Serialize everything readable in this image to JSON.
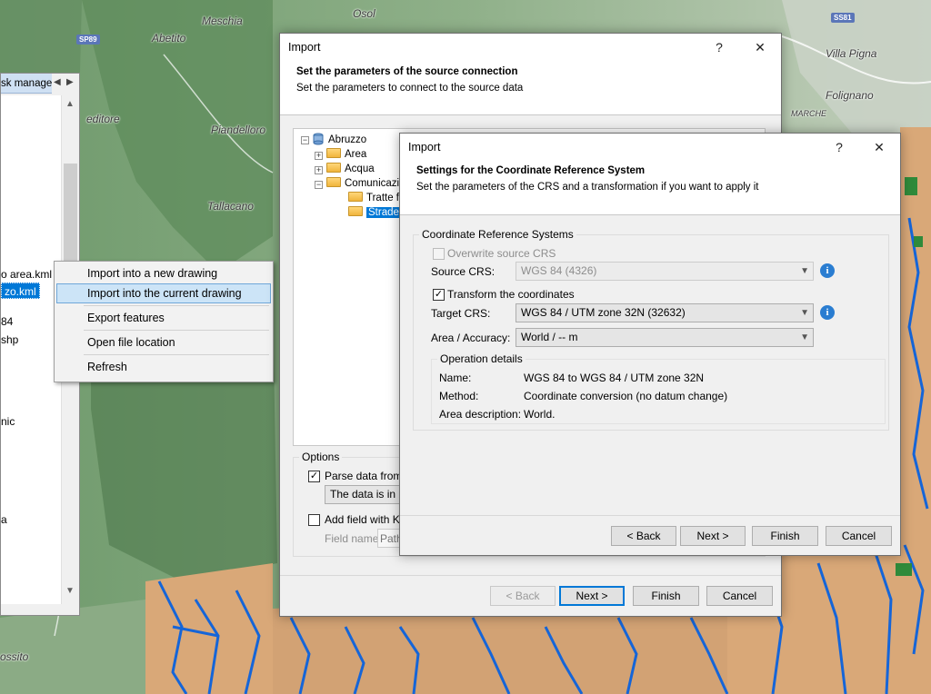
{
  "map": {
    "place_labels": [
      "Meschia",
      "Osol",
      "Abetito",
      "Villa Pigna",
      "Folignano",
      "Piandelloro",
      "Tallacano",
      "editore",
      "MARCHE",
      "ossito"
    ],
    "road_shields": [
      "SP89",
      "SS81"
    ]
  },
  "task_manager": {
    "tab_label": "sk manage",
    "items": [
      "o area.kml",
      "zo.kml",
      "84",
      "shp",
      "nic",
      "a"
    ],
    "selected_index": 1
  },
  "context_menu": {
    "items": [
      {
        "label": "Import into a new drawing",
        "highlighted": false
      },
      {
        "label": "Import into the current drawing",
        "highlighted": true
      },
      {
        "label": "Export features",
        "highlighted": false
      },
      {
        "label": "Open file location",
        "highlighted": false
      },
      {
        "label": "Refresh",
        "highlighted": false
      }
    ]
  },
  "dialog_main": {
    "title": "Import",
    "help": "?",
    "close": "✕",
    "header_title": "Set the parameters of the source connection",
    "header_subtitle": "Set the parameters to connect to the source data",
    "tree": {
      "root": "Abruzzo",
      "children": [
        "Area",
        "Acqua",
        "Comunicazi"
      ],
      "grandchildren": [
        "Tratte fe",
        "Strade"
      ]
    },
    "options": {
      "title": "Options",
      "parse_label": "Parse data from H",
      "parse_checked": true,
      "parse_combo": "The data is in 2 c",
      "add_field_label": "Add field with KM",
      "add_field_checked": false,
      "field_name_label": "Field name",
      "field_name_placeholder": "Path"
    },
    "buttons": {
      "back": "< Back",
      "next": "Next >",
      "finish": "Finish",
      "cancel": "Cancel"
    }
  },
  "dialog_crs": {
    "title": "Import",
    "help": "?",
    "close": "✕",
    "header_title": "Settings for the Coordinate Reference System",
    "header_subtitle": "Set the parameters of the CRS and a transformation if you want to apply it",
    "group_title": "Coordinate Reference Systems",
    "overwrite_label": "Overwrite source CRS",
    "overwrite_checked": false,
    "source_label": "Source CRS:",
    "source_value": "WGS 84 (4326)",
    "transform_label": "Transform the coordinates",
    "transform_checked": true,
    "target_label": "Target CRS:",
    "target_value": "WGS 84 / UTM zone 32N (32632)",
    "accuracy_label": "Area / Accuracy:",
    "accuracy_value": "World / -- m",
    "operation": {
      "title": "Operation details",
      "name_label": "Name:",
      "name_value": "WGS 84 to WGS 84 / UTM zone 32N",
      "method_label": "Method:",
      "method_value": "Coordinate conversion (no datum change)",
      "area_label": "Area description:",
      "area_value": "World."
    },
    "buttons": {
      "back": "< Back",
      "next": "Next >",
      "finish": "Finish",
      "cancel": "Cancel"
    }
  },
  "colors": {
    "relief_green": "#7fa47a",
    "relief_dark": "#4f7a4d",
    "lowland_tan": "#d9a878",
    "river_blue": "#1565d8",
    "selection_blue": "#0078d7"
  }
}
